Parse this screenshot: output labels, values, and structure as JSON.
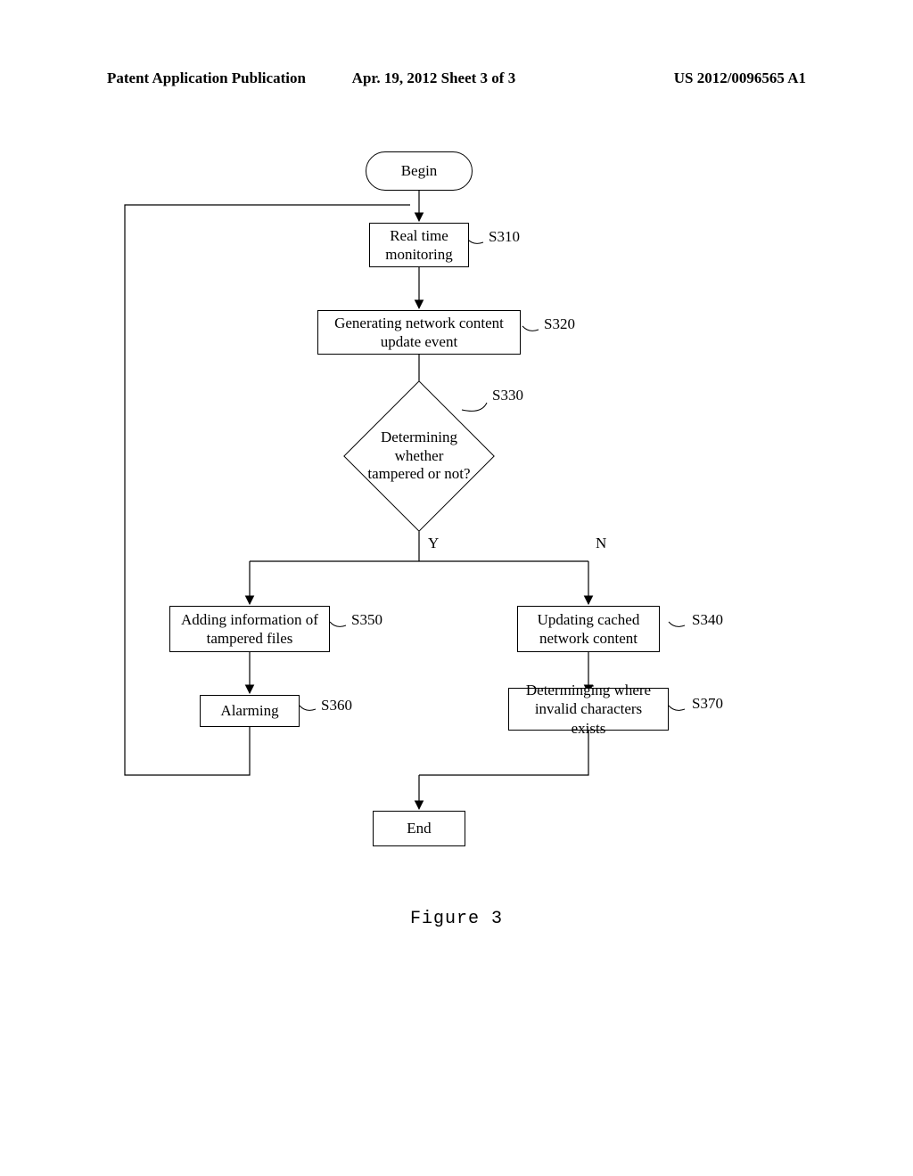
{
  "header": {
    "left": "Patent Application Publication",
    "mid": "Apr. 19, 2012  Sheet 3 of 3",
    "right": "US 2012/0096565 A1"
  },
  "nodes": {
    "begin": "Begin",
    "s310": {
      "label": "Real time\nmonitoring",
      "tag": "S310"
    },
    "s320": {
      "label": "Generating network content\nupdate event",
      "tag": "S320"
    },
    "s330": {
      "label": "Determining whether\ntampered or not?",
      "tag": "S330"
    },
    "s350": {
      "label": "Adding information of\ntampered files",
      "tag": "S350"
    },
    "s360": {
      "label": "Alarming",
      "tag": "S360"
    },
    "s340": {
      "label": "Updating cached\nnetwork content",
      "tag": "S340"
    },
    "s370": {
      "label": "Determinging where\ninvalid characters exists",
      "tag": "S370"
    },
    "end": "End"
  },
  "branches": {
    "yes": "Y",
    "no": "N"
  },
  "figure_caption": "Figure  3"
}
